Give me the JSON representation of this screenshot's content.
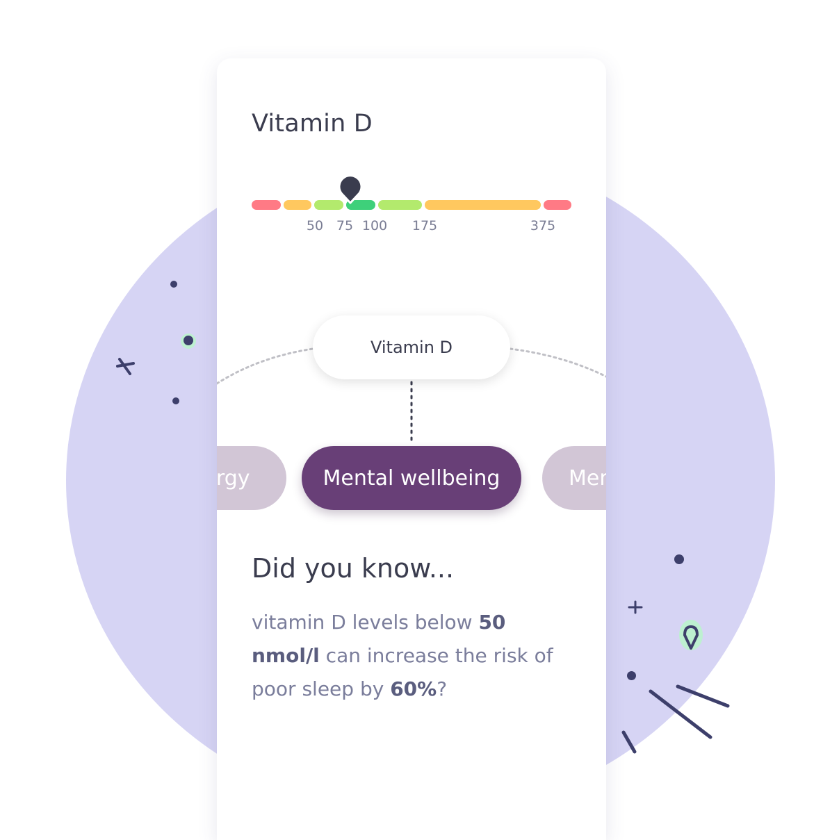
{
  "biomarker": {
    "title": "Vitamin D",
    "marker_value": 75
  },
  "range_bar": {
    "ticks": [
      "50",
      "75",
      "100",
      "175",
      "375"
    ],
    "colors": {
      "red": "#ff7a85",
      "orange": "#ffc85f",
      "light_green": "#b3ea6d",
      "green": "#3ed07a",
      "marker": "#3a3c4e"
    }
  },
  "hub": {
    "label": "Vitamin D"
  },
  "categories": {
    "left": "Energy",
    "center": "Mental wellbeing",
    "right": "Mental"
  },
  "did_you_know": {
    "title": "Did you know...",
    "text_1": "vitamin D levels below ",
    "bold_1": "50 nmol/l",
    "text_2": " can increase the risk of poor sleep by ",
    "bold_2": "60%",
    "text_3": "?"
  },
  "theme": {
    "background_blob": "#d6d4f4",
    "accent_purple": "#683f77",
    "inactive_pill": "#d2c6d6",
    "decoration_dark": "#3d3f6b",
    "decoration_mint": "#bdf0d0"
  }
}
